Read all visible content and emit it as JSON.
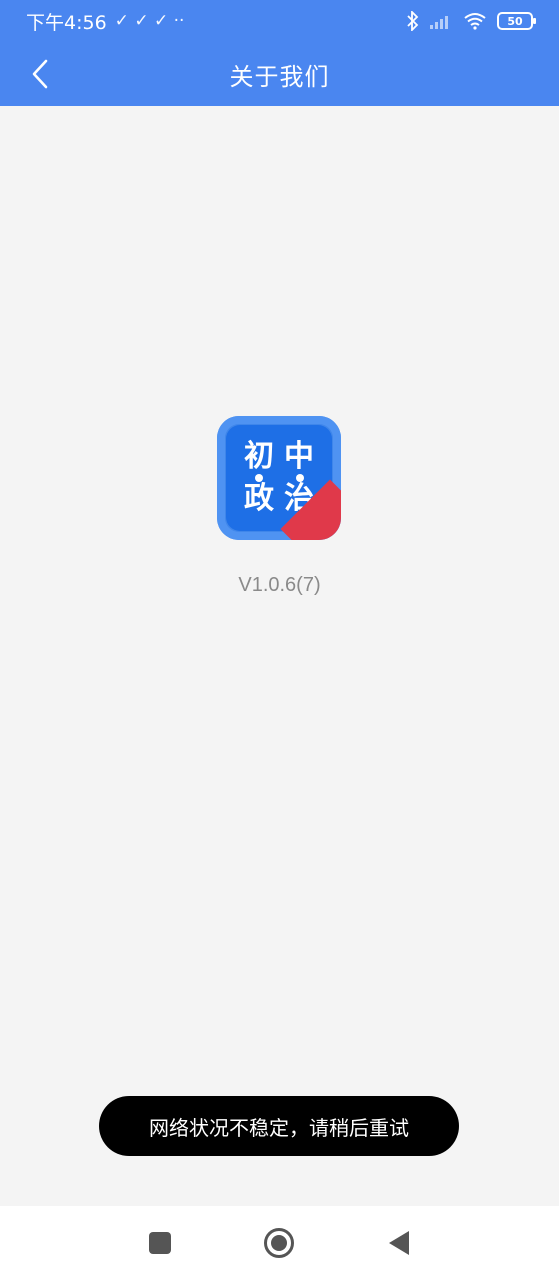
{
  "status_bar": {
    "time": "下午4:56",
    "left_glyphs": "✓ ✓ ✓ ··",
    "battery": "50"
  },
  "app_bar": {
    "title": "关于我们"
  },
  "about": {
    "logo_chars": [
      "初",
      "中",
      "政",
      "治"
    ],
    "version": "V1.0.6(7)"
  },
  "toast": {
    "message": "网络状况不稳定，请稍后重试"
  },
  "colors": {
    "primary": "#4a86f0",
    "logo_blue": "#1e6fe6",
    "ribbon_red": "#e0394a",
    "background": "#f4f4f4"
  }
}
